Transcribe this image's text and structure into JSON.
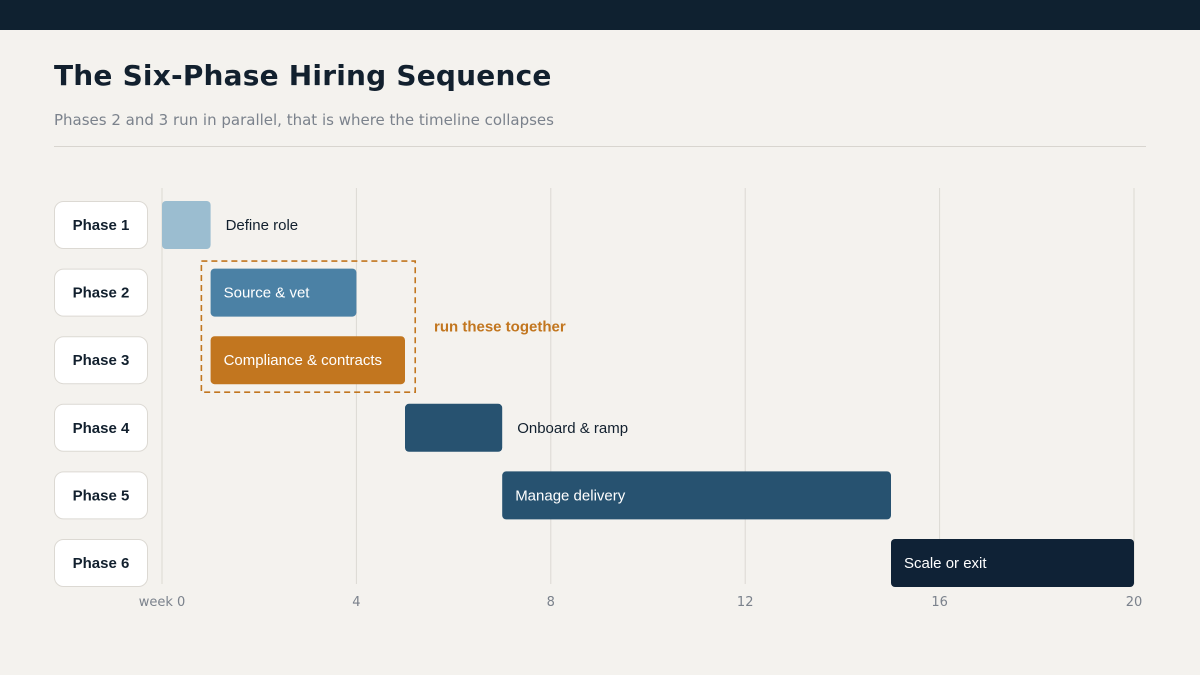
{
  "header": {
    "title": "The Six-Phase Hiring Sequence",
    "subtitle": "Phases 2 and 3 run in parallel, that is where the timeline collapses"
  },
  "colors": {
    "topbar": "#0f2130",
    "background": "#f4f2ee",
    "phase1": "#9bbdd0",
    "phase2": "#4b81a5",
    "phase3": "#c2761f",
    "phase4": "#275270",
    "phase5": "#275270",
    "phase6": "#0f2236",
    "grid": "#dcd9d3",
    "callout": "#c2761f"
  },
  "chart_data": {
    "type": "bar",
    "orientation": "horizontal-gantt",
    "title": "The Six-Phase Hiring Sequence",
    "subtitle": "Phases 2 and 3 run in parallel, that is where the timeline collapses",
    "xlim": [
      0,
      20
    ],
    "x_ticks": [
      0,
      4,
      8,
      12,
      16,
      20
    ],
    "x_tick_labels": [
      "week 0",
      "4",
      "8",
      "12",
      "16",
      "20"
    ],
    "grid": true,
    "phases": [
      {
        "row_label": "Phase 1",
        "task": "Define role",
        "start": 0,
        "end": 1,
        "color": "#9bbdd0",
        "label_position": "outside",
        "label_color": "#12202e"
      },
      {
        "row_label": "Phase 2",
        "task": "Source & vet",
        "start": 1,
        "end": 4,
        "color": "#4b81a5",
        "label_position": "inside",
        "label_color": "#ffffff"
      },
      {
        "row_label": "Phase 3",
        "task": "Compliance & contracts",
        "start": 1,
        "end": 5,
        "color": "#c2761f",
        "label_position": "inside",
        "label_color": "#ffffff"
      },
      {
        "row_label": "Phase 4",
        "task": "Onboard & ramp",
        "start": 5,
        "end": 7,
        "color": "#275270",
        "label_position": "outside",
        "label_color": "#12202e"
      },
      {
        "row_label": "Phase 5",
        "task": "Manage delivery",
        "start": 7,
        "end": 15,
        "color": "#275270",
        "label_position": "inside",
        "label_color": "#ffffff"
      },
      {
        "row_label": "Phase 6",
        "task": "Scale or exit",
        "start": 15,
        "end": 20,
        "color": "#0f2236",
        "label_position": "inside",
        "label_color": "#ffffff"
      }
    ],
    "annotation": {
      "text": "run these together",
      "rows": [
        2,
        3
      ],
      "x_start": 0.8,
      "x_end": 5.2
    }
  }
}
